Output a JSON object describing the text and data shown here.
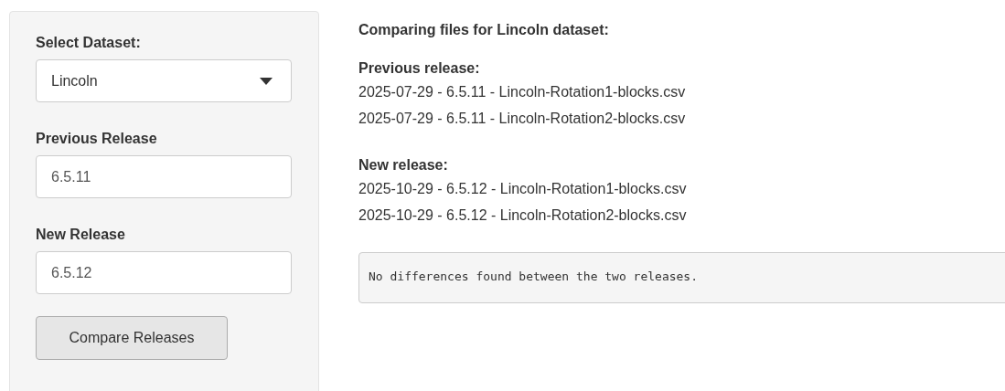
{
  "sidebar": {
    "dataset": {
      "label": "Select Dataset:",
      "value": "Lincoln"
    },
    "previous_release": {
      "label": "Previous Release",
      "value": "6.5.11"
    },
    "new_release": {
      "label": "New Release",
      "value": "6.5.12"
    },
    "button": "Compare Releases"
  },
  "main": {
    "heading": "Comparing files for Lincoln dataset:",
    "sections": [
      {
        "title": "Previous release:",
        "files": [
          "2025-07-29 - 6.5.11 - Lincoln-Rotation1-blocks.csv",
          "2025-07-29 - 6.5.11 - Lincoln-Rotation2-blocks.csv"
        ]
      },
      {
        "title": "New release:",
        "files": [
          "2025-10-29 - 6.5.12 - Lincoln-Rotation1-blocks.csv",
          "2025-10-29 - 6.5.12 - Lincoln-Rotation2-blocks.csv"
        ]
      }
    ],
    "output": "No differences found between the two releases."
  }
}
